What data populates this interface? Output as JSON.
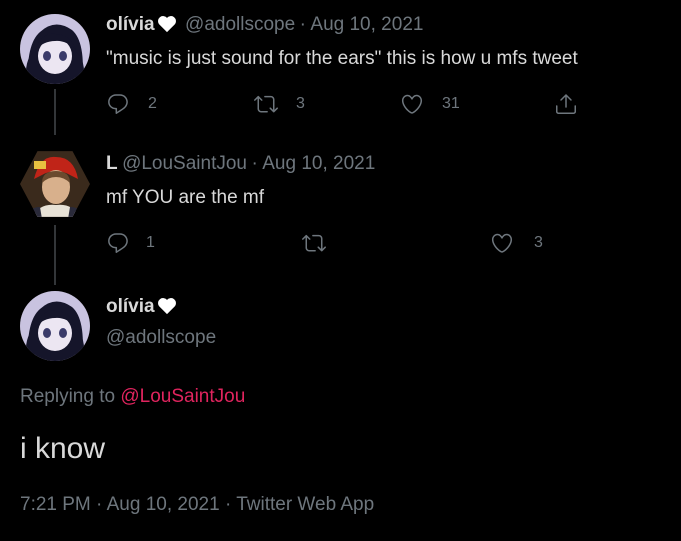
{
  "tweets": [
    {
      "name": "olívia",
      "handle": "@adollscope",
      "sep": "·",
      "date": "Aug 10, 2021",
      "text": "\"music is just sound for the ears\" this is how u mfs tweet",
      "replies": "2",
      "retweets": "3",
      "likes": "31"
    },
    {
      "name": "L",
      "handle": "@LouSaintJou",
      "sep": "·",
      "date": "Aug 10, 2021",
      "text": "mf YOU are the mf",
      "replies": "1",
      "retweets": "",
      "likes": "3"
    }
  ],
  "focus": {
    "name": "olívia",
    "handle": "@adollscope",
    "replying_prefix": "Replying to",
    "replying_mention": "@LouSaintJou",
    "text": "i know",
    "time": "7:21 PM",
    "sep1": "·",
    "date": "Aug 10, 2021",
    "sep2": "·",
    "source": "Twitter Web App"
  },
  "colors": {
    "background": "#000000",
    "text": "#d9d9d9",
    "muted": "#6e767d",
    "mention": "#e0245e"
  },
  "icons": [
    "heart-emoji-icon",
    "reply-icon",
    "retweet-icon",
    "like-icon",
    "share-icon"
  ]
}
